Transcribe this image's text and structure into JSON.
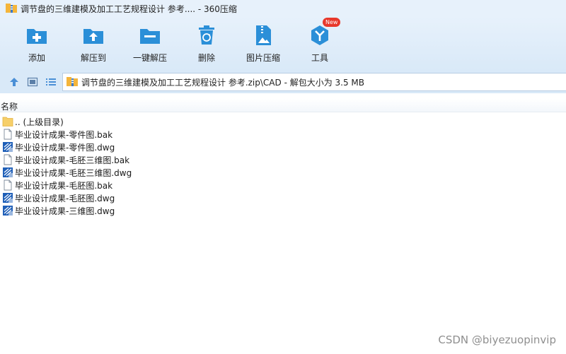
{
  "window": {
    "title": "调节盘的三维建模及加工工艺规程设计 参考.... - 360压缩"
  },
  "toolbar": {
    "items": [
      {
        "label": "添加",
        "icon": "add-icon"
      },
      {
        "label": "解压到",
        "icon": "extract-to-icon"
      },
      {
        "label": "一键解压",
        "icon": "one-click-extract-icon"
      },
      {
        "label": "删除",
        "icon": "delete-icon"
      },
      {
        "label": "图片压缩",
        "icon": "image-compress-icon"
      },
      {
        "label": "工具",
        "icon": "tools-icon",
        "badge": "New"
      }
    ]
  },
  "addressbar": {
    "path": "调节盘的三维建模及加工工艺规程设计 参考.zip\\CAD - 解包大小为 3.5 MB"
  },
  "filelist": {
    "column_name": "名称",
    "items": [
      {
        "name": ".. (上级目录)",
        "type": "folder"
      },
      {
        "name": "毕业设计成果-零件图.bak",
        "type": "bak"
      },
      {
        "name": "毕业设计成果-零件图.dwg",
        "type": "dwg"
      },
      {
        "name": "毕业设计成果-毛胚三维图.bak",
        "type": "bak"
      },
      {
        "name": "毕业设计成果-毛胚三维图.dwg",
        "type": "dwg"
      },
      {
        "name": "毕业设计成果-毛胚图.bak",
        "type": "bak"
      },
      {
        "name": "毕业设计成果-毛胚图.dwg",
        "type": "dwg"
      },
      {
        "name": "毕业设计成果-三维图.dwg",
        "type": "dwg"
      }
    ]
  },
  "watermark": "CSDN @biyezuopinvip",
  "colors": {
    "toolbar_bg": "#e7f1fb",
    "icon_blue": "#2b8fd8",
    "badge_red": "#e8382b"
  }
}
